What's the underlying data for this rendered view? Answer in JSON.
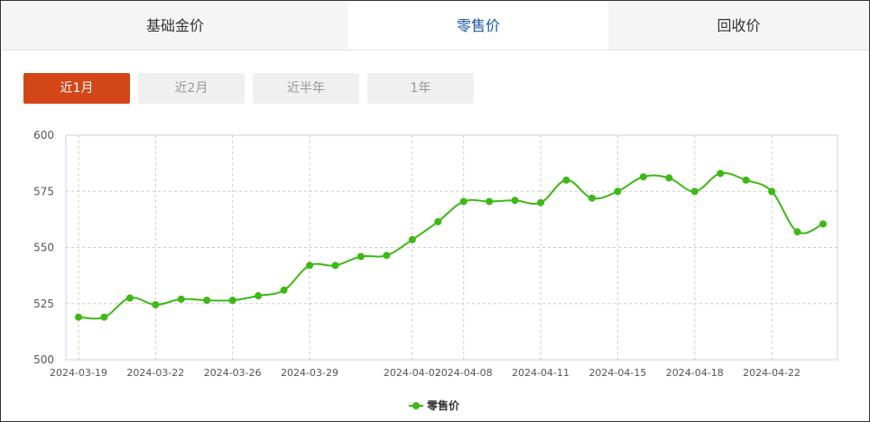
{
  "tabs": [
    {
      "label": "基础金价"
    },
    {
      "label": "零售价"
    },
    {
      "label": "回收价"
    }
  ],
  "ranges": [
    {
      "label": "近1月"
    },
    {
      "label": "近2月"
    },
    {
      "label": "近半年"
    },
    {
      "label": "1年"
    }
  ],
  "colors": {
    "series": "#3cb914",
    "active_range": "#d24617",
    "active_tab_text": "#1a55a3"
  },
  "chart_data": {
    "type": "line",
    "title": "",
    "xlabel": "",
    "ylabel": "",
    "ylim": [
      500,
      600
    ],
    "yticks": [
      500,
      525,
      550,
      575,
      600
    ],
    "grid": true,
    "legend_position": "bottom-center",
    "x_tick_labels": [
      "2024-03-19",
      "2024-03-22",
      "2024-03-26",
      "2024-03-29",
      "2024-04-02",
      "2024-04-08",
      "2024-04-11",
      "2024-04-15",
      "2024-04-18",
      "2024-04-22"
    ],
    "x": [
      "2024-03-19",
      "2024-03-20",
      "2024-03-21",
      "2024-03-22",
      "2024-03-23",
      "2024-03-25",
      "2024-03-26",
      "2024-03-27",
      "2024-03-28",
      "2024-03-29",
      "2024-03-30",
      "2024-03-31",
      "2024-04-01",
      "2024-04-02",
      "2024-04-03",
      "2024-04-08",
      "2024-04-09",
      "2024-04-10",
      "2024-04-11",
      "2024-04-12",
      "2024-04-13",
      "2024-04-15",
      "2024-04-16",
      "2024-04-17",
      "2024-04-18",
      "2024-04-19",
      "2024-04-20",
      "2024-04-22",
      "2024-04-23",
      "2024-04-24"
    ],
    "series": [
      {
        "name": "零售价",
        "values": [
          519,
          519,
          527.5,
          524.5,
          527,
          526.5,
          526.5,
          528.5,
          531,
          542,
          542,
          546,
          546.5,
          553.5,
          561.5,
          570.5,
          570.5,
          571,
          570,
          580,
          572,
          575,
          581.5,
          581,
          575,
          583,
          580,
          575,
          557,
          560.5
        ]
      }
    ]
  }
}
